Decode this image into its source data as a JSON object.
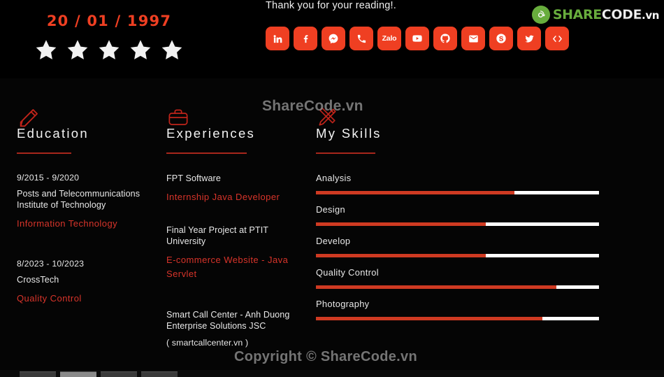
{
  "header": {
    "birth_date": "20 / 01 / 1997",
    "rating_stars": 5,
    "thanks_text": "Thank you for your reading!.",
    "social_links": [
      {
        "name": "linkedin-icon",
        "label": "LinkedIn"
      },
      {
        "name": "facebook-icon",
        "label": "Facebook"
      },
      {
        "name": "messenger-icon",
        "label": "Messenger"
      },
      {
        "name": "phone-icon",
        "label": "Phone"
      },
      {
        "name": "zalo-icon",
        "label": "Zalo"
      },
      {
        "name": "youtube-icon",
        "label": "YouTube"
      },
      {
        "name": "github-icon",
        "label": "GitHub"
      },
      {
        "name": "email-icon",
        "label": "Email"
      },
      {
        "name": "skype-icon",
        "label": "Skype"
      },
      {
        "name": "twitter-icon",
        "label": "Twitter"
      },
      {
        "name": "code-icon",
        "label": "Code"
      }
    ]
  },
  "logo": {
    "share": "SHARE",
    "code": "CODE",
    "vn": ".vn"
  },
  "education": {
    "icon": "pencil-icon",
    "title": "Education",
    "entries": [
      {
        "date": "9/2015 - 9/2020",
        "org": "Posts and Telecommunications Institute of Technology",
        "role": "Information Technology"
      },
      {
        "date": "8/2023 - 10/2023",
        "org": "CrossTech",
        "role": "Quality Control"
      }
    ]
  },
  "experiences": {
    "icon": "briefcase-icon",
    "title": "Experiences",
    "entries": [
      {
        "org": "FPT Software",
        "role": "Internship Java Developer"
      },
      {
        "org": "Final Year Project at PTIT University",
        "role": "E-commerce Website - Java Servlet"
      },
      {
        "org": "Smart Call Center - Anh Duong Enterprise Solutions JSC",
        "note": "( smartcallcenter.vn )"
      }
    ]
  },
  "skills": {
    "icon": "pen-ruler-icon",
    "title": "My Skills",
    "items": [
      {
        "label": "Analysis",
        "percent": 70
      },
      {
        "label": "Design",
        "percent": 60
      },
      {
        "label": "Develop",
        "percent": 60
      },
      {
        "label": "Quality Control",
        "percent": 85
      },
      {
        "label": "Photography",
        "percent": 80
      }
    ]
  },
  "watermarks": {
    "middle": "ShareCode.vn",
    "bottom": "Copyright © ShareCode.vn"
  },
  "colors": {
    "accent_red": "#cf3a22",
    "icon_red": "#c0241a",
    "social_red": "#ef3f22",
    "brand_green": "#6cb33f",
    "background": "#050505"
  },
  "taskbar": {
    "items": [
      "",
      "",
      "",
      ""
    ],
    "active_index": 1
  }
}
